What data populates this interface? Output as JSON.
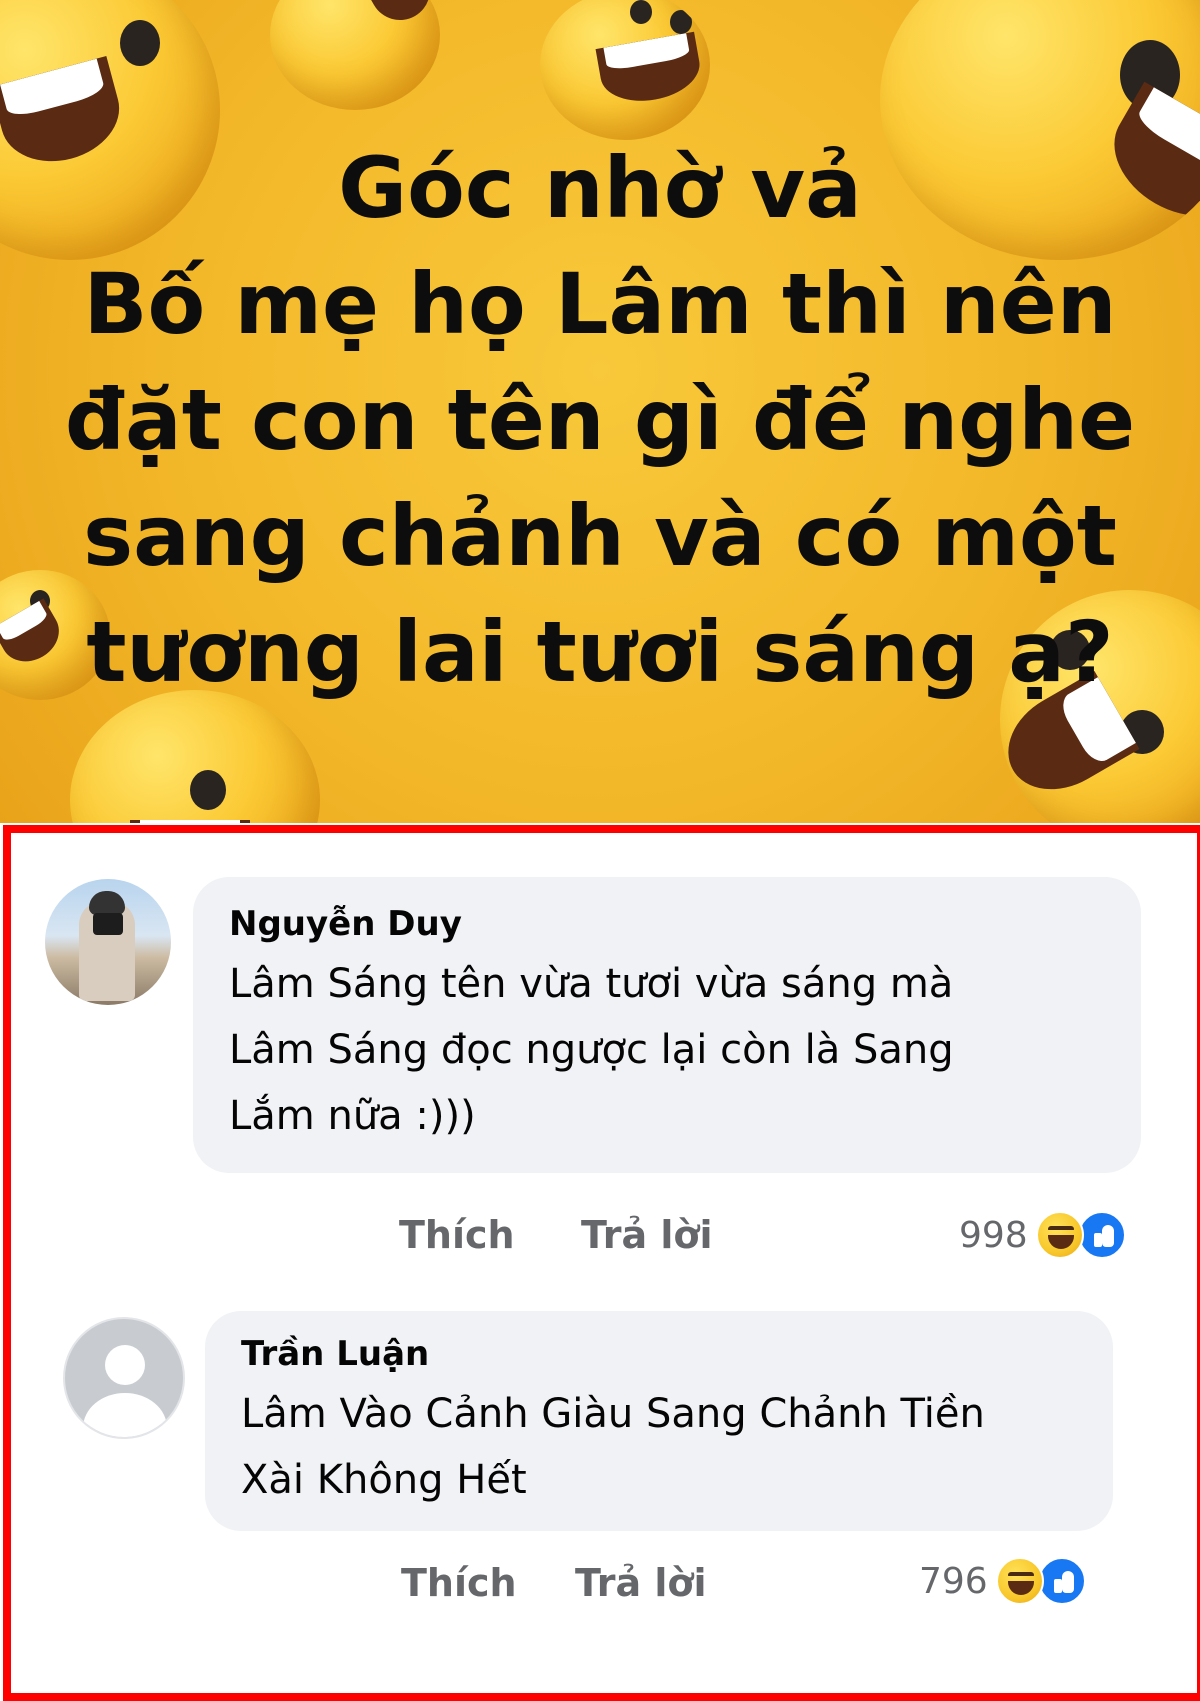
{
  "post": {
    "title_lines": [
      "Góc nhờ vả",
      "Bố mẹ họ Lâm thì nên",
      "đặt con tên gì để nghe",
      "sang chảnh và có một",
      "tương lai tươi sáng ạ?"
    ]
  },
  "comments": [
    {
      "author": "Nguyễn Duy",
      "text_lines": [
        "Lâm Sáng tên vừa tươi vừa sáng mà",
        "Lâm Sáng đọc ngược lại còn là Sang",
        "Lắm nữa :)))"
      ],
      "like_label": "Thích",
      "reply_label": "Trả lời",
      "reaction_count": "998",
      "reaction_icons": [
        "haha-icon",
        "like-icon"
      ]
    },
    {
      "author": "Trần Luận",
      "text_lines": [
        "Lâm Vào Cảnh Giàu Sang Chảnh Tiền",
        "Xài Không Hết"
      ],
      "like_label": "Thích",
      "reply_label": "Trả lời",
      "reaction_count": "796",
      "reaction_icons": [
        "haha-icon",
        "like-icon"
      ]
    }
  ],
  "colors": {
    "banner_yellow": "#f3b82a",
    "panel_border": "#ff0000",
    "bubble_bg": "#f0f2f5",
    "action_gray": "#65676b",
    "like_blue": "#1877f2"
  }
}
